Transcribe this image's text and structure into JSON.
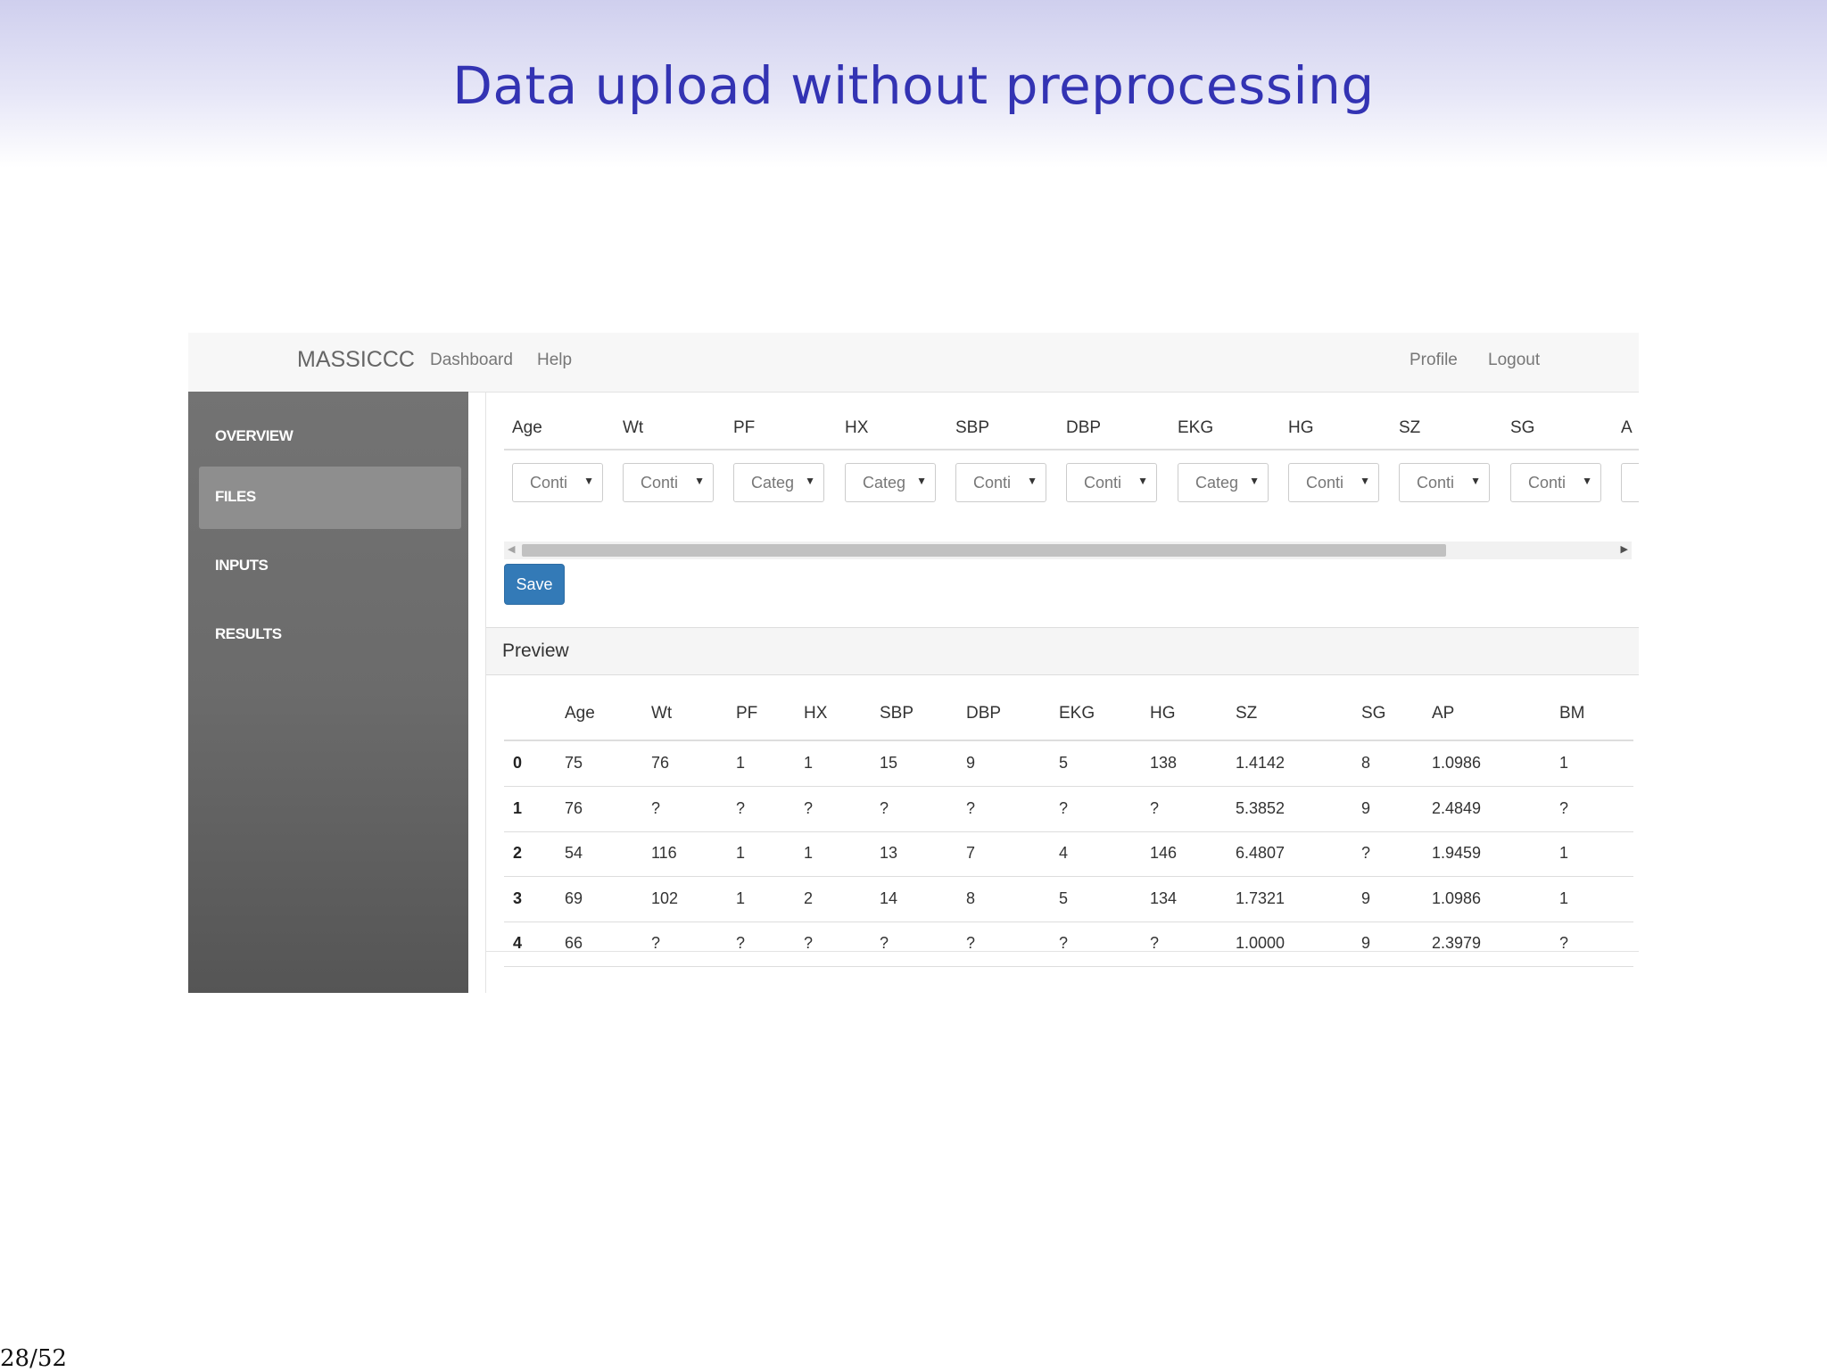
{
  "slide": {
    "title": "Data upload without preprocessing",
    "page_number": "28/52"
  },
  "navbar": {
    "brand": "MASSICCC",
    "links": [
      "Dashboard",
      "Help"
    ],
    "right_links": [
      "Profile",
      "Logout"
    ]
  },
  "sidebar": {
    "items": [
      {
        "label": "OVERVIEW",
        "active": false
      },
      {
        "label": "FILES",
        "active": true
      },
      {
        "label": "INPUTS",
        "active": false
      },
      {
        "label": "RESULTS",
        "active": false
      }
    ]
  },
  "types_panel": {
    "columns": [
      "Age",
      "Wt",
      "PF",
      "HX",
      "SBP",
      "DBP",
      "EKG",
      "HG",
      "SZ",
      "SG",
      "A"
    ],
    "selects": [
      "Conti",
      "Conti",
      "Categ",
      "Categ",
      "Conti",
      "Conti",
      "Categ",
      "Conti",
      "Conti",
      "Conti",
      ""
    ],
    "scroll_left_glyph": "◀",
    "scroll_right_glyph": "▶",
    "caret_glyph": "▼",
    "save_label": "Save"
  },
  "preview": {
    "heading": "Preview",
    "header": [
      "",
      "Age",
      "Wt",
      "PF",
      "HX",
      "SBP",
      "DBP",
      "EKG",
      "HG",
      "SZ",
      "SG",
      "AP",
      "BM"
    ],
    "rows": [
      [
        "0",
        "75",
        "76",
        "1",
        "1",
        "15",
        "9",
        "5",
        "138",
        "1.4142",
        "8",
        "1.0986",
        "1"
      ],
      [
        "1",
        "76",
        "?",
        "?",
        "?",
        "?",
        "?",
        "?",
        "?",
        "5.3852",
        "9",
        "2.4849",
        "?"
      ],
      [
        "2",
        "54",
        "116",
        "1",
        "1",
        "13",
        "7",
        "4",
        "146",
        "6.4807",
        "?",
        "1.9459",
        "1"
      ],
      [
        "3",
        "69",
        "102",
        "1",
        "2",
        "14",
        "8",
        "5",
        "134",
        "1.7321",
        "9",
        "1.0986",
        "1"
      ],
      [
        "4",
        "66",
        "?",
        "?",
        "?",
        "?",
        "?",
        "?",
        "?",
        "1.0000",
        "9",
        "2.3979",
        "?"
      ]
    ]
  }
}
